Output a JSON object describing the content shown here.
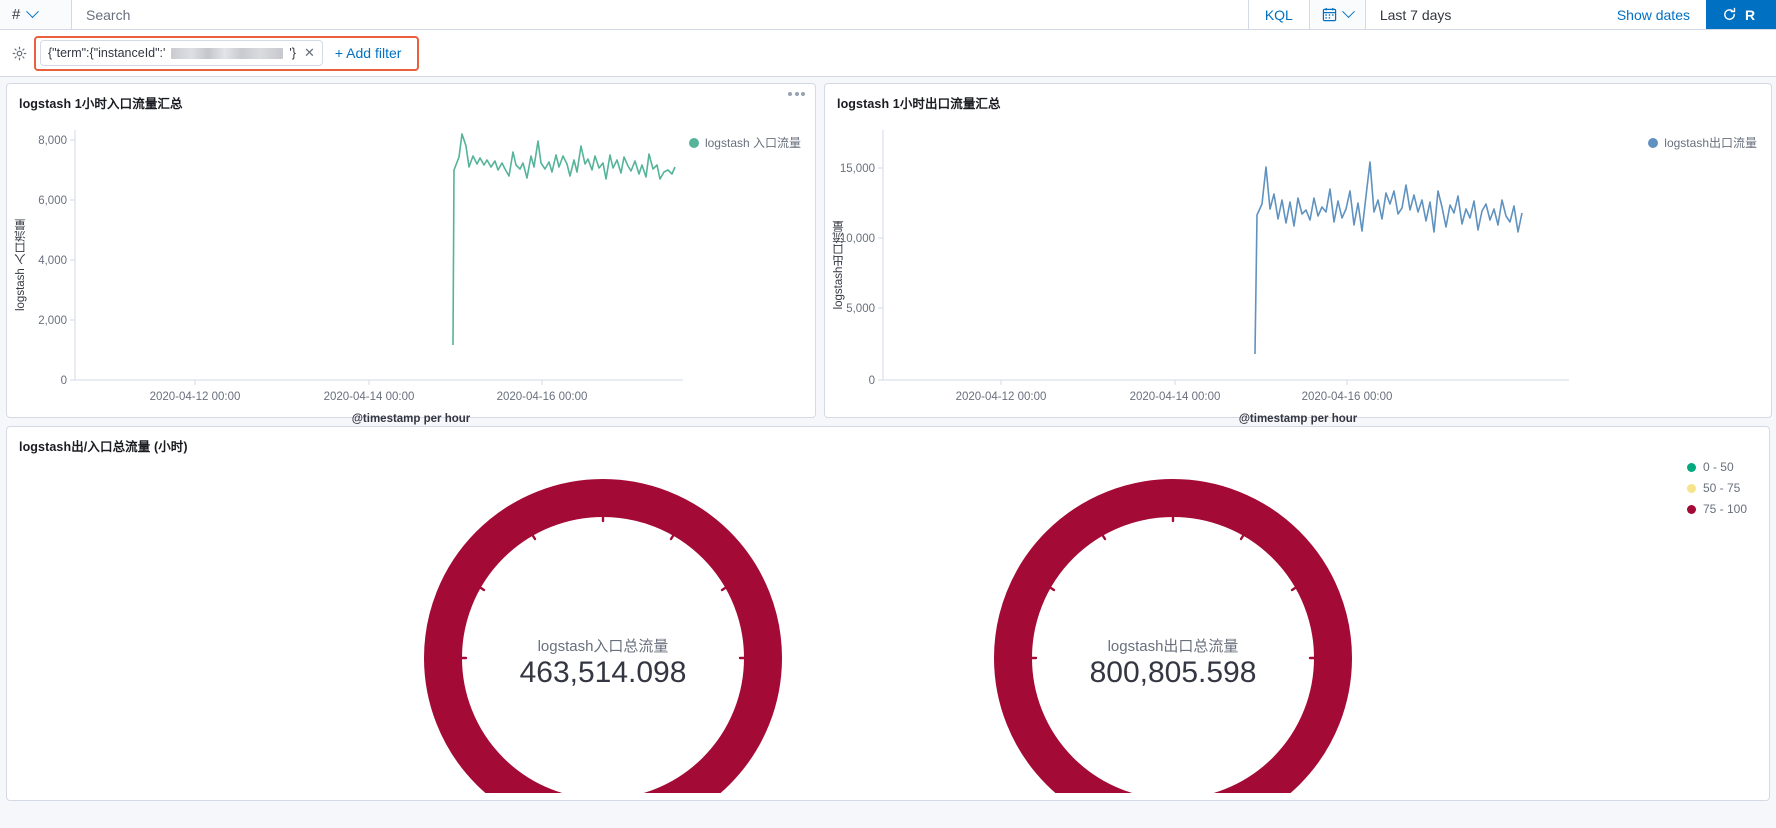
{
  "query_bar": {
    "dataview_glyph": "#",
    "dataview_icon": "chevron-down-icon",
    "search_placeholder": "Search",
    "search_value": "",
    "language_label": "KQL",
    "calendar_icon": "calendar-icon",
    "date_range_label": "Last 7 days",
    "show_dates_label": "Show dates",
    "refresh_icon": "refresh-icon",
    "refresh_label": "R"
  },
  "filter_bar": {
    "settings_icon": "gear-icon",
    "filter_pill_prefix": "{\"term\":{\"instanceId\":'",
    "filter_pill_suffix": "'}",
    "filter_pill_redacted": "redacted-value",
    "filter_remove_icon": "close-icon",
    "add_filter_label": "+ Add filter",
    "highlight_color": "#E8613C"
  },
  "panels": [
    {
      "title": "logstash 1小时入口流量汇总",
      "menu_icon": "panel-context-menu-icon",
      "legend_label": "logstash 入口流量",
      "legend_color": "#54B399"
    },
    {
      "title": "logstash 1小时出口流量汇总",
      "legend_label": "logstash出口流量",
      "legend_color": "#6092C0"
    },
    {
      "title": "logstash出/入口总流量 (小时)"
    }
  ],
  "gauge_legend": [
    {
      "label": "0 - 50",
      "color": "#00A97E"
    },
    {
      "label": "50 - 75",
      "color": "#F6E38A"
    },
    {
      "label": "75 - 100",
      "color": "#A30A35"
    }
  ],
  "gauges": [
    {
      "label": "logstash入口总流量",
      "value": "463,514.098",
      "arc_color": "#A30A35"
    },
    {
      "label": "logstash出口总流量",
      "value": "800,805.598",
      "arc_color": "#A30A35"
    }
  ],
  "chart_data": [
    {
      "type": "line",
      "title": "logstash 1小时入口流量汇总",
      "xlabel": "@timestamp per hour",
      "ylabel": "logstash 入口流量",
      "series": [
        {
          "name": "logstash 入口流量",
          "color": "#54B399",
          "values": [
            1150,
            7000,
            7500,
            8150,
            7850,
            7250,
            7600,
            7350,
            7500,
            7300,
            7450,
            7250,
            7400,
            7150,
            7350,
            7200,
            7000,
            7650,
            7300,
            7200,
            7350,
            6950,
            7550,
            7250,
            7900,
            7350,
            7200,
            7400,
            7150,
            7600,
            7250,
            7550,
            7300,
            7000,
            7450,
            7150,
            7850,
            7250,
            7400,
            7100,
            7500,
            7200,
            7350,
            6900,
            7600,
            7200,
            7450,
            7050,
            7500,
            7250,
            7100,
            7400,
            7000,
            7300,
            6950,
            7550,
            7150,
            7250,
            6900,
            7100
          ]
        }
      ],
      "x_ticks": [
        "2020-04-12 00:00",
        "2020-04-14 00:00",
        "2020-04-16 00:00"
      ],
      "y_ticks": [
        "0",
        "2,000",
        "4,000",
        "6,000",
        "8,000"
      ],
      "ylim": [
        0,
        8800
      ],
      "grid": false,
      "legend_position": "top-right"
    },
    {
      "type": "line",
      "title": "logstash 1小时出口流量汇总",
      "xlabel": "@timestamp per hour",
      "ylabel": "logstash出口流量",
      "series": [
        {
          "name": "logstash出口流量",
          "color": "#6092C0",
          "values": [
            1950,
            11800,
            12600,
            15300,
            12500,
            13700,
            11500,
            13200,
            11200,
            12900,
            11000,
            13400,
            11800,
            12100,
            11400,
            13000,
            11700,
            12400,
            11900,
            13600,
            11300,
            12800,
            11600,
            12200,
            13900,
            11100,
            12700,
            10600,
            13300,
            15600,
            12000,
            13100,
            11500,
            14000,
            12600,
            13800,
            11800,
            12300,
            14200,
            11900,
            13500,
            12100,
            13000,
            11400,
            12900,
            10500,
            13600,
            12200,
            11000,
            12400
          ]
        }
      ],
      "x_ticks": [
        "2020-04-12 00:00",
        "2020-04-14 00:00",
        "2020-04-16 00:00"
      ],
      "y_ticks": [
        "0",
        "5,000",
        "10,000",
        "15,000"
      ],
      "ylim": [
        0,
        17000
      ],
      "grid": false,
      "legend_position": "top-right"
    }
  ]
}
